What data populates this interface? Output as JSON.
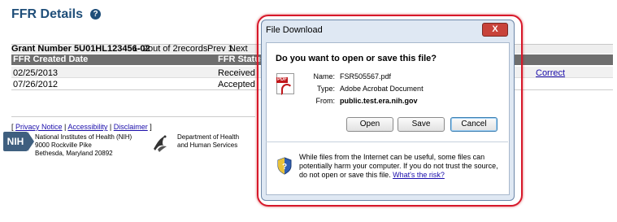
{
  "page": {
    "title": "FFR Details",
    "help_icon": "?"
  },
  "grant": {
    "number": "Grant Number 5U01HL123456-02",
    "records": "1- 2out of 2records",
    "prev": "Prev 1",
    "next": "Next"
  },
  "table": {
    "headers": [
      "FFR Created Date",
      "FFR Status"
    ],
    "rows": [
      {
        "date": "02/25/2013",
        "status": "Received",
        "action": "Correct"
      },
      {
        "date": "07/26/2012",
        "status": "Accepted",
        "action": ""
      }
    ]
  },
  "footer": {
    "links": [
      "Privacy Notice",
      "Accessibility",
      "Disclaimer"
    ],
    "nih_logo": "NIH",
    "nih_address": [
      "National Institutes of Health (NIH)",
      "9000 Rockville Pike",
      "Bethesda, Maryland 20892"
    ],
    "hhs_text": [
      "Department of Health",
      "and Human Services"
    ]
  },
  "dialog": {
    "title": "File Download",
    "close": "X",
    "question": "Do you want to open or save this file?",
    "name_label": "Name:",
    "name_value": "FSR505567.pdf",
    "type_label": "Type:",
    "type_value": "Adobe Acrobat Document",
    "from_label": "From:",
    "from_value": "public.test.era.nih.gov",
    "buttons": {
      "open": "Open",
      "save": "Save",
      "cancel": "Cancel"
    },
    "warning": "While files from the Internet can be useful, some files can potentially harm your computer. If you do not trust the source, do not open or save this file.",
    "warning_link": "What's the risk?",
    "pdf_badge": "PDF"
  },
  "colors": {
    "title": "#1f4e79",
    "table_header": "#6e6e6e",
    "highlight": "#d7182a",
    "link": "#1a0dab"
  }
}
